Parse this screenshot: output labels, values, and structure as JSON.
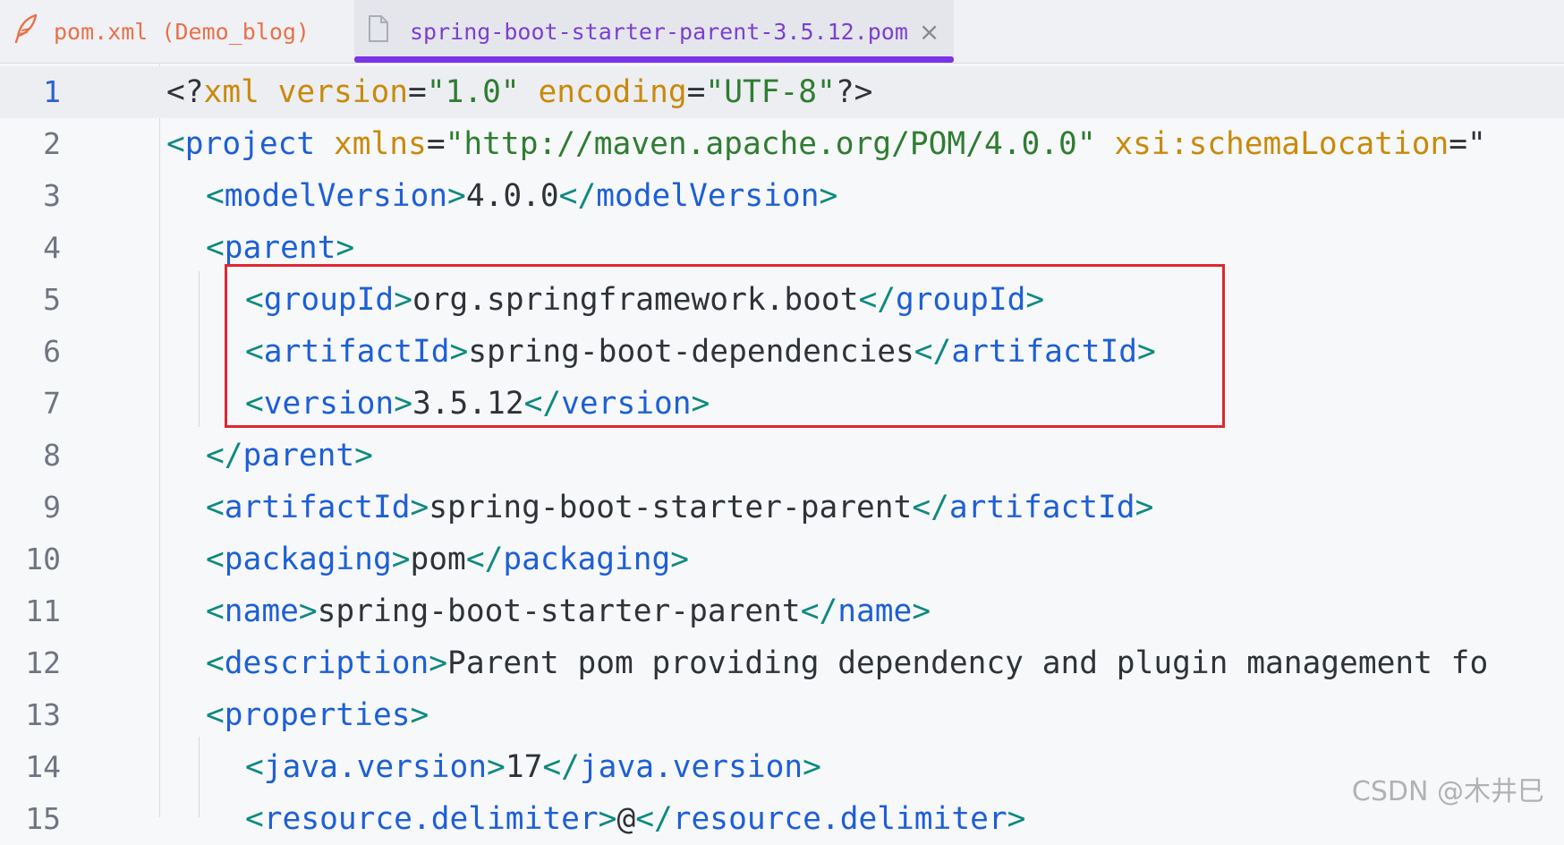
{
  "tabs": [
    {
      "label": "pom.xml (Demo_blog)",
      "icon": "feather-icon",
      "active": false
    },
    {
      "label": "spring-boot-starter-parent-3.5.12.pom",
      "icon": "file-icon",
      "active": true,
      "close": "×"
    }
  ],
  "colors": {
    "accent": "#7c32e6",
    "tag": "#1d5fd6",
    "bracket": "#0e8a80",
    "attribute": "#c98a0a",
    "highlight_border": "#e0262f"
  },
  "lines": [
    {
      "n": "1"
    },
    {
      "n": "2"
    },
    {
      "n": "3"
    },
    {
      "n": "4"
    },
    {
      "n": "5"
    },
    {
      "n": "6"
    },
    {
      "n": "7"
    },
    {
      "n": "8"
    },
    {
      "n": "9"
    },
    {
      "n": "10"
    },
    {
      "n": "11"
    },
    {
      "n": "12"
    },
    {
      "n": "13"
    },
    {
      "n": "14"
    },
    {
      "n": "15"
    }
  ],
  "code": {
    "l1": {
      "open": "<?",
      "name": "xml",
      "attr1": "version",
      "eq1": "=",
      "val1": "\"1.0\"",
      "attr2": "encoding",
      "eq2": "=",
      "val2": "\"UTF-8\"",
      "close": "?>"
    },
    "l2": {
      "open": "<",
      "tag": "project",
      "attr1": "xmlns",
      "eq1": "=",
      "val1": "\"http://maven.apache.org/POM/4.0.0\"",
      "attr2": "xsi:schemaLocation",
      "eq2": "=\""
    },
    "l3": {
      "tag": "modelVersion",
      "value": "4.0.0"
    },
    "l4": {
      "tag": "parent"
    },
    "l5": {
      "tag": "groupId",
      "value": "org.springframework.boot"
    },
    "l6": {
      "tag": "artifactId",
      "value": "spring-boot-dependencies"
    },
    "l7": {
      "tag": "version",
      "value": "3.5.12"
    },
    "l8": {
      "tag": "parent"
    },
    "l9": {
      "tag": "artifactId",
      "value": "spring-boot-starter-parent"
    },
    "l10": {
      "tag": "packaging",
      "value": "pom"
    },
    "l11": {
      "tag": "name",
      "value": "spring-boot-starter-parent"
    },
    "l12": {
      "tag": "description",
      "value": "Parent pom providing dependency and plugin management fo"
    },
    "l13": {
      "tag": "properties"
    },
    "l14": {
      "tag": "java.version",
      "value": "17"
    },
    "l15": {
      "tag": "resource.delimiter",
      "value": "@"
    }
  },
  "watermark": "CSDN @木井巳"
}
